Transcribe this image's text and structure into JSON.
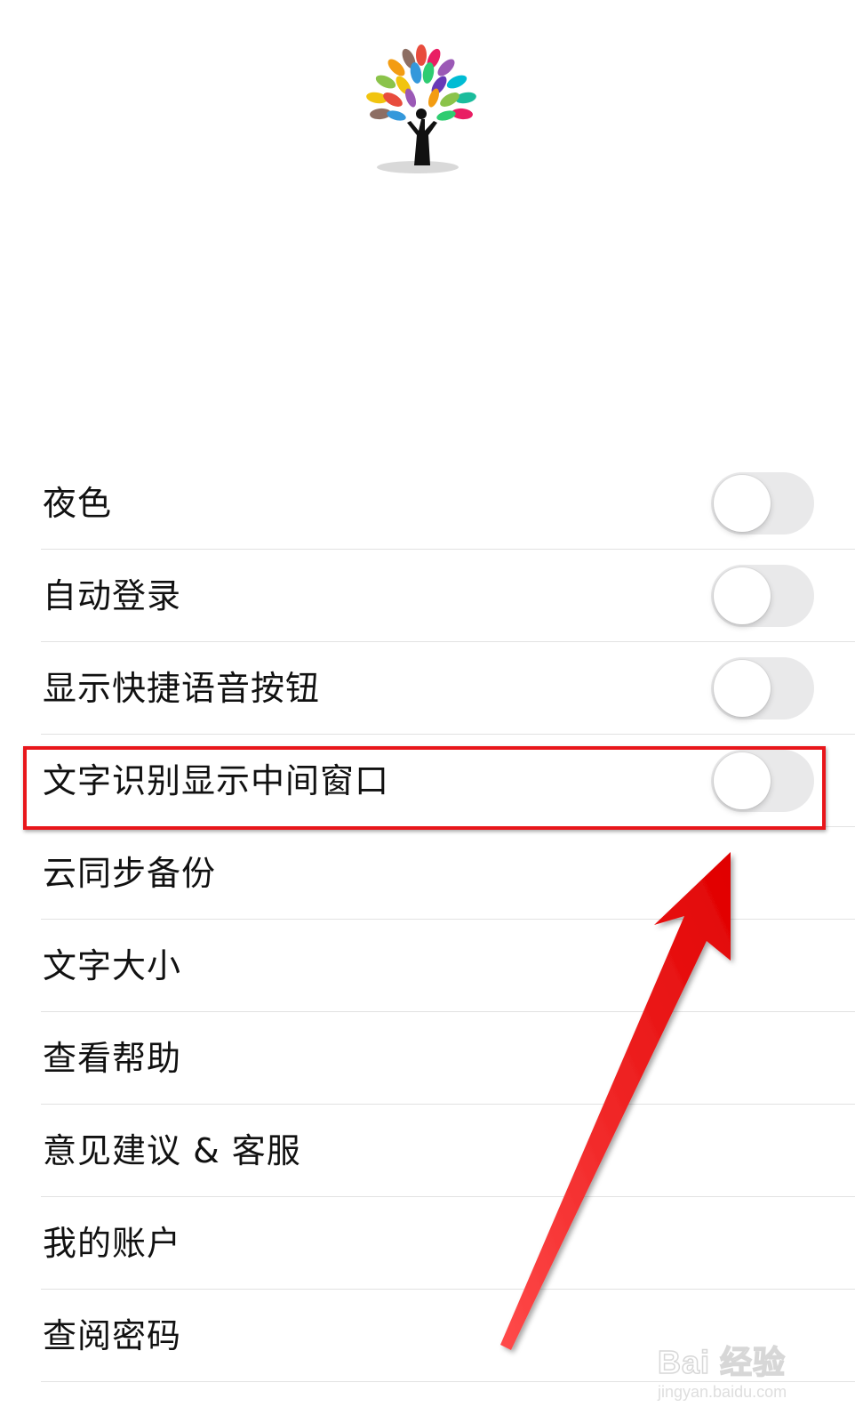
{
  "logo": {
    "icon": "colorful-tree-logo-icon",
    "leaf_colors": [
      "#e84c3d",
      "#f39c12",
      "#f1c40f",
      "#2ecc71",
      "#1abc9c",
      "#3498db",
      "#9b59b6",
      "#e91e63",
      "#8d6e63",
      "#8bc34a",
      "#00bcd4",
      "#673ab7"
    ]
  },
  "settings": {
    "items": [
      {
        "label": "夜色",
        "has_toggle": true,
        "toggle_on": false
      },
      {
        "label": "自动登录",
        "has_toggle": true,
        "toggle_on": false
      },
      {
        "label": "显示快捷语音按钮",
        "has_toggle": true,
        "toggle_on": false
      },
      {
        "label": "文字识别显示中间窗口",
        "has_toggle": true,
        "toggle_on": false
      },
      {
        "label": "云同步备份",
        "has_toggle": false
      },
      {
        "label": "文字大小",
        "has_toggle": false
      },
      {
        "label": "查看帮助",
        "has_toggle": false
      },
      {
        "label": "意见建议 & 客服",
        "has_toggle": false
      },
      {
        "label": "我的账户",
        "has_toggle": false
      },
      {
        "label": "查阅密码",
        "has_toggle": false
      }
    ]
  },
  "annotation": {
    "highlight_color": "#e8161b",
    "arrow_color": "#ff1010"
  },
  "watermark": {
    "brand": "Bai 经验",
    "url": "jingyan.baidu.com"
  },
  "colors": {
    "toggle_off_track": "#e9e9ea",
    "divider": "#e2e2e2",
    "text": "#111111"
  }
}
